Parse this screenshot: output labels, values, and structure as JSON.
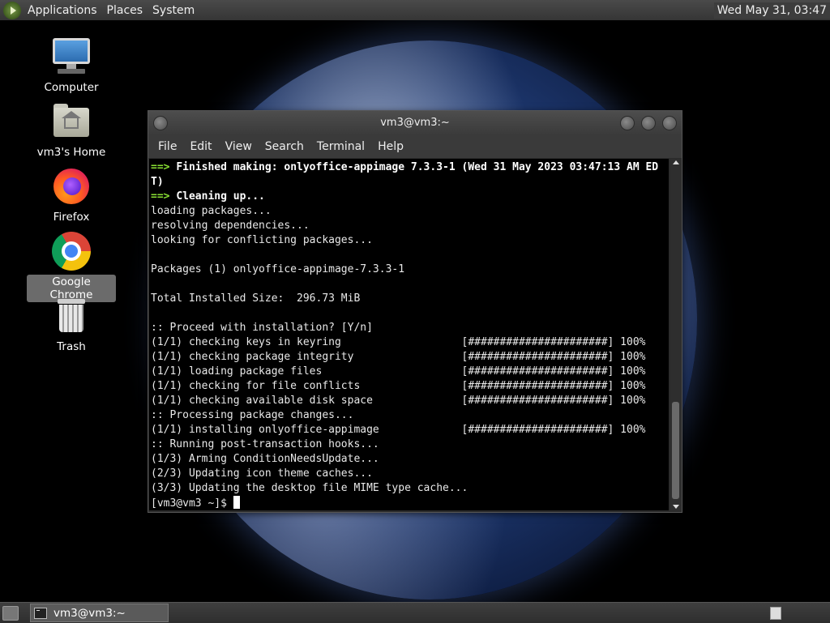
{
  "top_panel": {
    "menus": [
      "Applications",
      "Places",
      "System"
    ],
    "clock": "Wed May 31, 03:47"
  },
  "desktop_icons": [
    {
      "label": "Computer",
      "icon": "computer-icon"
    },
    {
      "label": "vm3's Home",
      "icon": "home-folder-icon"
    },
    {
      "label": "Firefox",
      "icon": "firefox-icon"
    },
    {
      "label": "Google Chrome",
      "icon": "chrome-icon",
      "selected": true
    },
    {
      "label": "Trash",
      "icon": "trash-icon"
    }
  ],
  "terminal": {
    "title": "vm3@vm3:~",
    "menu": [
      "File",
      "Edit",
      "View",
      "Search",
      "Terminal",
      "Help"
    ],
    "lines": [
      {
        "prefix": "==> ",
        "text": "Finished making: onlyoffice-appimage 7.3.3-1 (Wed 31 May 2023 03:47:13 AM ED",
        "bold": true
      },
      {
        "prefix": "",
        "text": "T)",
        "bold": true
      },
      {
        "prefix": "==> ",
        "text": "Cleaning up...",
        "bold": true
      },
      {
        "prefix": "",
        "text": "loading packages..."
      },
      {
        "prefix": "",
        "text": "resolving dependencies..."
      },
      {
        "prefix": "",
        "text": "looking for conflicting packages..."
      },
      {
        "prefix": "",
        "text": ""
      },
      {
        "prefix": "",
        "text": "Packages (1) onlyoffice-appimage-7.3.3-1"
      },
      {
        "prefix": "",
        "text": ""
      },
      {
        "prefix": "",
        "text": "Total Installed Size:  296.73 MiB"
      },
      {
        "prefix": "",
        "text": ""
      },
      {
        "prefix": "",
        "text": ":: Proceed with installation? [Y/n]"
      },
      {
        "prefix": "",
        "text": "(1/1) checking keys in keyring                   [######################] 100%"
      },
      {
        "prefix": "",
        "text": "(1/1) checking package integrity                 [######################] 100%"
      },
      {
        "prefix": "",
        "text": "(1/1) loading package files                      [######################] 100%"
      },
      {
        "prefix": "",
        "text": "(1/1) checking for file conflicts                [######################] 100%"
      },
      {
        "prefix": "",
        "text": "(1/1) checking available disk space              [######################] 100%"
      },
      {
        "prefix": "",
        "text": ":: Processing package changes..."
      },
      {
        "prefix": "",
        "text": "(1/1) installing onlyoffice-appimage             [######################] 100%"
      },
      {
        "prefix": "",
        "text": ":: Running post-transaction hooks..."
      },
      {
        "prefix": "",
        "text": "(1/3) Arming ConditionNeedsUpdate..."
      },
      {
        "prefix": "",
        "text": "(2/3) Updating icon theme caches..."
      },
      {
        "prefix": "",
        "text": "(3/3) Updating the desktop file MIME type cache..."
      }
    ],
    "prompt": "[vm3@vm3 ~]$ "
  },
  "bottom_panel": {
    "task_label": "vm3@vm3:~"
  },
  "colors": {
    "arrow": "#8ae234",
    "terminal_bg": "#000000",
    "panel_bg": "#3a3a3a"
  }
}
